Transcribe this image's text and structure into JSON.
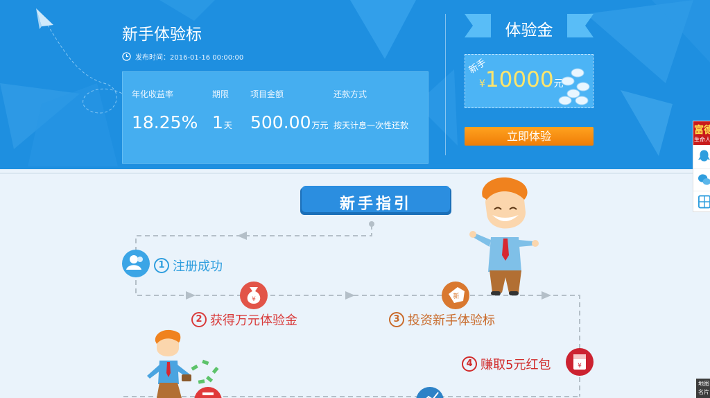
{
  "hero": {
    "title": "新手体验标",
    "publish_time": "发布时间：2016-01-16 00:00:00",
    "stats": [
      {
        "label": "年化收益率",
        "value": "18.25%",
        "unit": ""
      },
      {
        "label": "期限",
        "value": "1",
        "unit": "天"
      },
      {
        "label": "项目金额",
        "value": "500.00",
        "unit": "万元"
      },
      {
        "label": "还款方式",
        "value": "按天计息一次性还款",
        "unit": ""
      }
    ]
  },
  "bonus": {
    "title": "体验金",
    "coupon_tag": "新手",
    "currency": "¥",
    "amount": "10000",
    "unit": "元",
    "cta": "立即体验"
  },
  "guide": {
    "banner": "新手指引",
    "steps": [
      {
        "num": "1",
        "label": "注册成功"
      },
      {
        "num": "2",
        "label": "获得万元体验金"
      },
      {
        "num": "3",
        "label": "投资新手体验标"
      },
      {
        "num": "4",
        "label": "赚取5元红包"
      }
    ],
    "icon_badges": {
      "coin_bag": "¥",
      "tag": "新",
      "red_packet": "¥"
    }
  },
  "sidebar": {
    "brand_main": "富德",
    "brand_sub": "生命人寿",
    "items": [
      {
        "icon": "qq-icon"
      },
      {
        "icon": "wechat-icon"
      },
      {
        "icon": "calculator-icon"
      }
    ]
  },
  "map_tab": {
    "line1": "地图",
    "line2": "名片"
  },
  "colors": {
    "hero_bg": "#1e8fe0",
    "panel_bg": "#45aef0",
    "cta_orange": "#f28a10",
    "guide_bg": "#eaf3fb",
    "step_blue": "#2f9ede",
    "step_red": "#d93a3a",
    "step_brown": "#c96a2a"
  }
}
